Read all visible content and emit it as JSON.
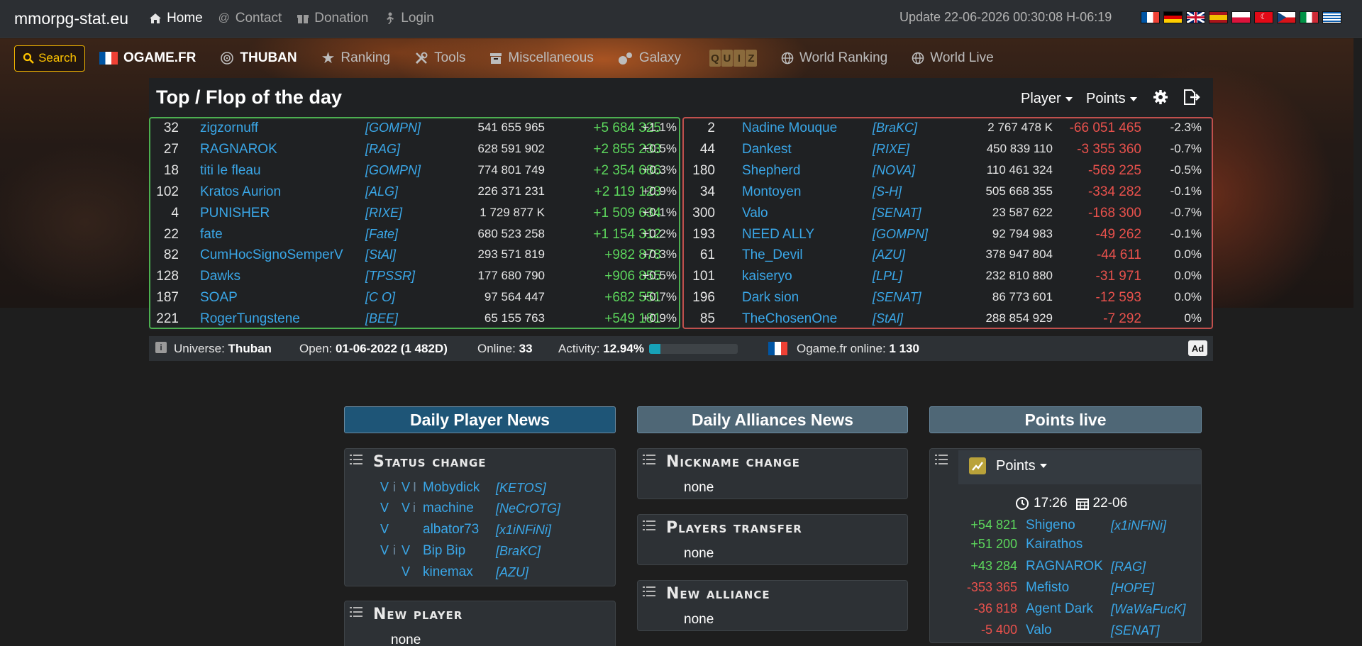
{
  "topbar": {
    "brand": "mmorpg-stat.eu",
    "links": [
      {
        "label": "Home",
        "icon": "home-icon"
      },
      {
        "label": "Contact",
        "icon": "at-icon"
      },
      {
        "label": "Donation",
        "icon": "gift-icon"
      },
      {
        "label": "Login",
        "icon": "login-icon"
      }
    ],
    "update": "Update 22-06-2026 00:30:08 H-06:19",
    "flags": [
      "fr",
      "de",
      "gb",
      "es",
      "pl",
      "tr",
      "cz",
      "it",
      "gr"
    ]
  },
  "navbar": {
    "search": "Search",
    "server": "OGAME.FR",
    "universe": "THUBAN",
    "items": [
      "Ranking",
      "Tools",
      "Miscellaneous",
      "Galaxy"
    ],
    "quiz": [
      "Q",
      "U",
      "I",
      "Z"
    ],
    "items2": [
      "World Ranking",
      "World Live"
    ]
  },
  "topflop": {
    "title": "Top / Flop of the day",
    "player_dropdown": "Player",
    "points_dropdown": "Points",
    "top": [
      {
        "rank": "32",
        "name": "zigzornuff",
        "tag": "[GOMPN]",
        "points": "541 655 965",
        "delta": "+5 684 325",
        "pct": "+1.1%"
      },
      {
        "rank": "27",
        "name": "RAGNAROK",
        "tag": "[RAG]",
        "points": "628 591 902",
        "delta": "+2 855 233",
        "pct": "+0.5%"
      },
      {
        "rank": "18",
        "name": "titi le fleau",
        "tag": "[GOMPN]",
        "points": "774 801 749",
        "delta": "+2 354 686",
        "pct": "+0.3%"
      },
      {
        "rank": "102",
        "name": "Kratos Aurion",
        "tag": "[ALG]",
        "points": "226 371 231",
        "delta": "+2 119 123",
        "pct": "+0.9%"
      },
      {
        "rank": "4",
        "name": "PUNISHER",
        "tag": "[RIXE]",
        "points": "1 729 877 K",
        "delta": "+1 509 634",
        "pct": "+0.1%"
      },
      {
        "rank": "22",
        "name": "fate",
        "tag": "[Fate]",
        "points": "680 523 258",
        "delta": "+1 154 312",
        "pct": "+0.2%"
      },
      {
        "rank": "82",
        "name": "CumHocSignoSemperV",
        "tag": "[StAl]",
        "points": "293 571 819",
        "delta": "+982 878",
        "pct": "+0.3%"
      },
      {
        "rank": "128",
        "name": "Dawks",
        "tag": "[TPSSR]",
        "points": "177 680 790",
        "delta": "+906 855",
        "pct": "+0.5%"
      },
      {
        "rank": "187",
        "name": "SOAP",
        "tag": "[C O]",
        "points": "97 564 447",
        "delta": "+682 551",
        "pct": "+0.7%"
      },
      {
        "rank": "221",
        "name": "RogerTungstene",
        "tag": "[BEE]",
        "points": "65 155 763",
        "delta": "+549 181",
        "pct": "+0.9%"
      }
    ],
    "flop": [
      {
        "rank": "2",
        "name": "Nadine Mouque",
        "tag": "[BraKC]",
        "points": "2 767 478 K",
        "delta": "-66 051 465",
        "pct": "-2.3%"
      },
      {
        "rank": "44",
        "name": "Dankest",
        "tag": "[RIXE]",
        "points": "450 839 110",
        "delta": "-3 355 360",
        "pct": "-0.7%"
      },
      {
        "rank": "180",
        "name": "Shepherd",
        "tag": "[NOVA]",
        "points": "110 461 324",
        "delta": "-569 225",
        "pct": "-0.5%"
      },
      {
        "rank": "34",
        "name": "Montoyen",
        "tag": "[S-H]",
        "points": "505 668 355",
        "delta": "-334 282",
        "pct": "-0.1%"
      },
      {
        "rank": "300",
        "name": "Valo",
        "tag": "[SENAT]",
        "points": "23 587 622",
        "delta": "-168 300",
        "pct": "-0.7%"
      },
      {
        "rank": "193",
        "name": "NEED ALLY",
        "tag": "[GOMPN]",
        "points": "92 794 983",
        "delta": "-49 262",
        "pct": "-0.1%"
      },
      {
        "rank": "61",
        "name": "The_Devil",
        "tag": "[AZU]",
        "points": "378 947 804",
        "delta": "-44 611",
        "pct": "0.0%"
      },
      {
        "rank": "101",
        "name": "kaiseryo",
        "tag": "[LPL]",
        "points": "232 810 880",
        "delta": "-31 971",
        "pct": "0.0%"
      },
      {
        "rank": "196",
        "name": "Dark sion",
        "tag": "[SENAT]",
        "points": "86 773 601",
        "delta": "-12 593",
        "pct": "0.0%"
      },
      {
        "rank": "85",
        "name": "TheChosenOne",
        "tag": "[StAl]",
        "points": "288 854 929",
        "delta": "-7 292",
        "pct": "0%"
      }
    ]
  },
  "universe_bar": {
    "universe_label": "Universe:",
    "universe_value": "Thuban",
    "open_label": "Open:",
    "open_value": "01-06-2022 (1 482D)",
    "online_label": "Online:",
    "online_value": "33",
    "activity_label": "Activity:",
    "activity_value": "12.94%",
    "activity_fraction": 0.1294,
    "server_online_label": "Ogame.fr online:",
    "server_online_value": "1 130",
    "ad": "Ad"
  },
  "columns": {
    "player_news": "Daily Player News",
    "alliance_news": "Daily Alliances News",
    "points_live": "Points live"
  },
  "status_change": {
    "title": "Status change",
    "rows": [
      {
        "s1": "V",
        "s2": "i",
        "s3": "V",
        "s4": "I",
        "name": "Mobydick",
        "tag": "[KETOS]"
      },
      {
        "s1": "V",
        "s2": "",
        "s3": "V",
        "s4": "i",
        "name": "machine",
        "tag": "[NeCrOTG]"
      },
      {
        "s1": "V",
        "s2": "",
        "s3": "",
        "s4": "",
        "name": "albator73",
        "tag": "[x1iNFiNi]"
      },
      {
        "s1": "V",
        "s2": "i",
        "s3": "V",
        "s4": "",
        "name": "Bip Bip",
        "tag": "[BraKC]"
      },
      {
        "s1": "",
        "s2": "",
        "s3": "V",
        "s4": "",
        "name": "kinemax",
        "tag": "[AZU]"
      }
    ]
  },
  "new_player": {
    "title": "New player",
    "value": "none"
  },
  "nickname_change": {
    "title": "Nickname change",
    "value": "none"
  },
  "players_transfer": {
    "title": "Players transfer",
    "value": "none"
  },
  "new_alliance": {
    "title": "New alliance",
    "value": "none"
  },
  "points_live_card": {
    "dropdown": "Points",
    "time": "17:26",
    "date": "22-06",
    "rows": [
      {
        "delta": "+54 821",
        "name": "Shigeno",
        "name2": "Kairathos",
        "tag": "[x1iNFiNi]",
        "sign": "pos"
      },
      {
        "delta": "+51 200",
        "name": "",
        "name2": "",
        "tag": "",
        "sign": "pos"
      },
      {
        "delta": "+43 284",
        "name": "RAGNAROK",
        "name2": "",
        "tag": "[RAG]",
        "sign": "pos"
      },
      {
        "delta": "-353 365",
        "name": "Mefisto",
        "name2": "",
        "tag": "[HOPE]",
        "sign": "neg"
      },
      {
        "delta": "-36 818",
        "name": "Agent Dark",
        "name2": "",
        "tag": "[WaWaFucK]",
        "sign": "neg"
      },
      {
        "delta": "-5 400",
        "name": "Valo",
        "name2": "",
        "tag": "[SENAT]",
        "sign": "neg"
      }
    ]
  },
  "colors": {
    "link": "#3aa7e8",
    "positive": "#5cd65c",
    "negative": "#e8514c",
    "top_border": "#4caf50",
    "flop_border": "#c0504d",
    "accent_search": "#ffc400"
  }
}
